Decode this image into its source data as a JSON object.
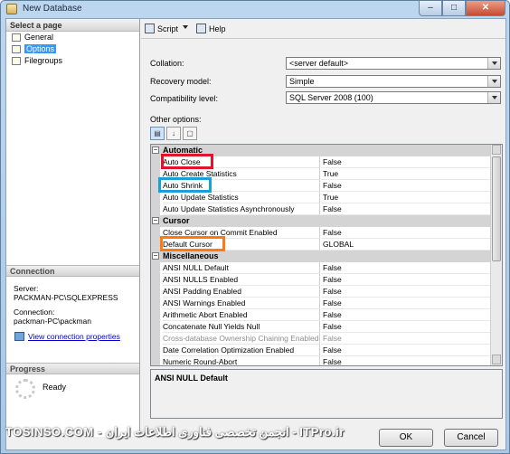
{
  "window": {
    "title": "New Database",
    "min": "–",
    "max": "□",
    "close": "✕"
  },
  "sidebar": {
    "heading": "Select a page",
    "items": [
      {
        "label": "General",
        "selected": false
      },
      {
        "label": "Options",
        "selected": true
      },
      {
        "label": "Filegroups",
        "selected": false
      }
    ]
  },
  "connection": {
    "heading": "Connection",
    "server_label": "Server:",
    "server_value": "PACKMAN-PC\\SQLEXPRESS",
    "conn_label": "Connection:",
    "conn_value": "packman-PC\\packman",
    "link": "View connection properties"
  },
  "progress": {
    "heading": "Progress",
    "status": "Ready"
  },
  "toolbar": {
    "script": "Script",
    "help": "Help"
  },
  "form": {
    "collation_label": "Collation:",
    "collation_value": "<server default>",
    "recovery_label": "Recovery model:",
    "recovery_value": "Simple",
    "compat_label": "Compatibility level:",
    "compat_value": "SQL Server 2008 (100)",
    "other_label": "Other options:"
  },
  "grid": {
    "rows": [
      {
        "type": "cat",
        "name": "Automatic"
      },
      {
        "type": "prop",
        "name": "Auto Close",
        "value": "False"
      },
      {
        "type": "prop",
        "name": "Auto Create Statistics",
        "value": "True"
      },
      {
        "type": "prop",
        "name": "Auto Shrink",
        "value": "False"
      },
      {
        "type": "prop",
        "name": "Auto Update Statistics",
        "value": "True"
      },
      {
        "type": "prop",
        "name": "Auto Update Statistics Asynchronously",
        "value": "False"
      },
      {
        "type": "cat",
        "name": "Cursor"
      },
      {
        "type": "prop",
        "name": "Close Cursor on Commit Enabled",
        "value": "False"
      },
      {
        "type": "prop",
        "name": "Default Cursor",
        "value": "GLOBAL"
      },
      {
        "type": "cat",
        "name": "Miscellaneous"
      },
      {
        "type": "prop",
        "name": "ANSI NULL Default",
        "value": "False"
      },
      {
        "type": "prop",
        "name": "ANSI NULLS Enabled",
        "value": "False"
      },
      {
        "type": "prop",
        "name": "ANSI Padding Enabled",
        "value": "False"
      },
      {
        "type": "prop",
        "name": "ANSI Warnings Enabled",
        "value": "False"
      },
      {
        "type": "prop",
        "name": "Arithmetic Abort Enabled",
        "value": "False"
      },
      {
        "type": "prop",
        "name": "Concatenate Null Yields Null",
        "value": "False"
      },
      {
        "type": "prop",
        "name": "Cross-database Ownership Chaining Enabled",
        "value": "False",
        "disabled": true
      },
      {
        "type": "prop",
        "name": "Date Correlation Optimization Enabled",
        "value": "False"
      },
      {
        "type": "prop",
        "name": "Numeric Round-Abort",
        "value": "False"
      }
    ],
    "description_title": "ANSI NULL Default"
  },
  "buttons": {
    "ok": "OK",
    "cancel": "Cancel"
  },
  "watermark": "TOSINSO.COM - انجمن تخصصی فناوری اطلاعات ایران - ITPro.ir",
  "colors": {
    "highlight_red": "#e0142a",
    "highlight_blue": "#1aa0d8",
    "highlight_orange": "#ff7a12",
    "selection": "#3399ff"
  }
}
